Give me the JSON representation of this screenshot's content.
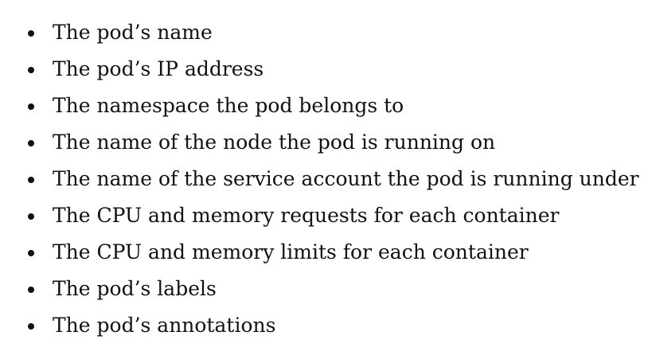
{
  "list": {
    "items": [
      {
        "text": "The pod’s name"
      },
      {
        "text": "The pod’s IP address"
      },
      {
        "text": "The namespace the pod belongs to"
      },
      {
        "text": "The name of the node the pod is running on"
      },
      {
        "text": "The name of the service account the pod is running under"
      },
      {
        "text": "The CPU and memory requests for each container"
      },
      {
        "text": "The CPU and memory limits for each container"
      },
      {
        "text": "The pod’s labels"
      },
      {
        "text": "The pod’s annotations"
      }
    ]
  }
}
